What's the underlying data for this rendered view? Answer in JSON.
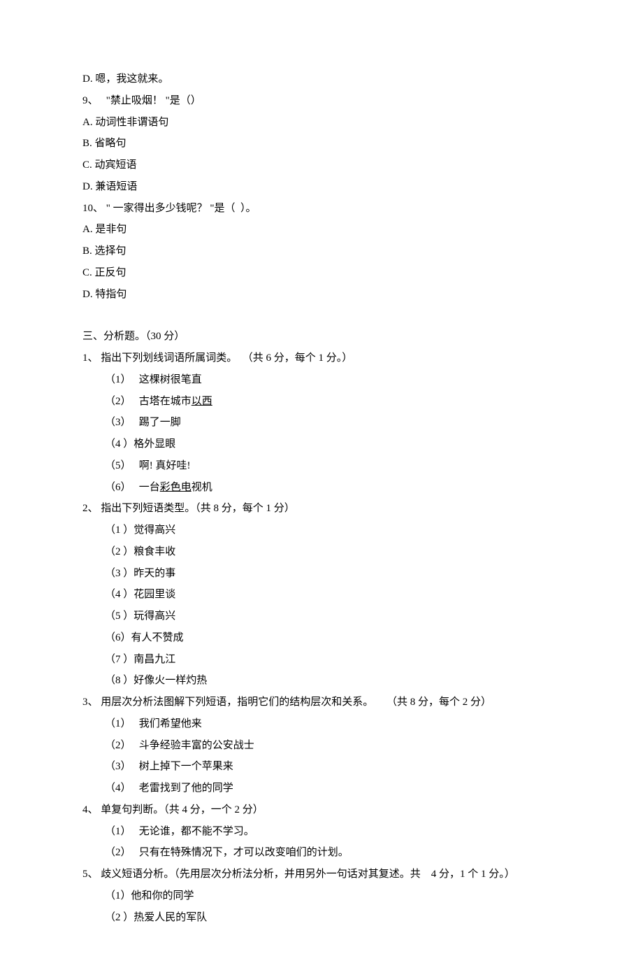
{
  "q8": {
    "D": "D. 嗯，我这就来。"
  },
  "q9": {
    "stem": "9、   \"禁止吸烟！ \"是（）",
    "A": "A. 动词性非谓语句",
    "B": "B. 省略句",
    "C": "C. 动宾短语",
    "D": "D. 兼语短语"
  },
  "q10": {
    "stem": "10、 \" 一家得出多少钱呢？ \"是（  ）。",
    "A": "A. 是非句",
    "B": "B. 选择句",
    "C": "C. 正反句",
    "D": "D. 特指句"
  },
  "section3": {
    "header": "三、分析题。（30 分）",
    "a1": {
      "stem": "1、 指出下列划线词语所属词类。  （共 6 分，每个 1 分。）",
      "i1": "（1）   这棵树很笔直",
      "i2_a": "（2）   古塔在城市",
      "i2_u": "以西",
      "i3": "（3）   踢了一脚",
      "i4": "（4 ）格外显眼",
      "i5": "（5）   啊! 真好哇!",
      "i6_a": "（6）   一台",
      "i6_u": "彩色电",
      "i6_b": "视机"
    },
    "a2": {
      "stem": "2、 指出下列短语类型。（共 8 分，每个 1 分）",
      "i1": "（1 ）觉得高兴",
      "i2": "（2 ）粮食丰收",
      "i3": "（3 ）昨天的事",
      "i4": "（4 ）花园里谈",
      "i5": "（5 ）玩得高兴",
      "i6": "（6）有人不赞成",
      "i7": "（7 ）南昌九江",
      "i8": "（8 ）好像火一样灼热"
    },
    "a3": {
      "stem": "3、 用层次分析法图解下列短语，指明它们的结构层次和关系。     （共 8 分，每个 2 分）",
      "i1": "（1）   我们希望他来",
      "i2": "（2）   斗争经验丰富的公安战士",
      "i3": "（3）   树上掉下一个苹果来",
      "i4": "（4）   老雷找到了他的同学"
    },
    "a4": {
      "stem": "4、 单复句判断。（共 4 分，一个 2 分）",
      "i1": "（1）   无论谁，都不能不学习。",
      "i2": "（2）   只有在特殊情况下，才可以改变咱们的计划。"
    },
    "a5": {
      "stem": "5、 歧义短语分析。（先用层次分析法分析，并用另外一句话对其复述。共    4 分，1 个 1 分。）",
      "i1": "（1）他和你的同学",
      "i2": "（2 ）热爱人民的军队"
    }
  }
}
